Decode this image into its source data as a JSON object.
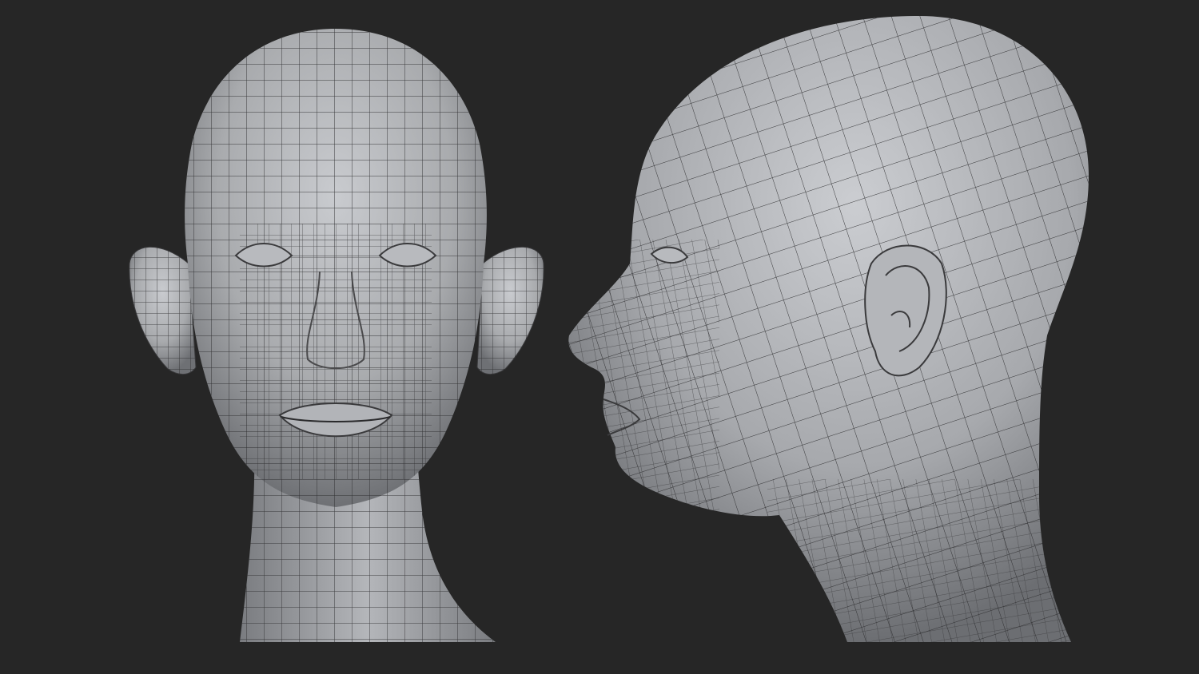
{
  "scene": {
    "background_color": "#262626",
    "mesh_base_color": "#a9abae",
    "mesh_highlight_color": "#c9cbcf",
    "mesh_shadow_color": "#6e7074",
    "wire_color": "#2a2a2c",
    "views": [
      {
        "name": "front-view"
      },
      {
        "name": "side-view"
      }
    ]
  }
}
